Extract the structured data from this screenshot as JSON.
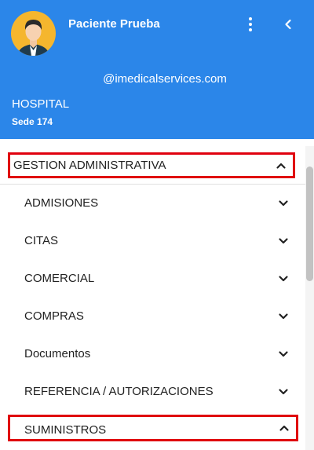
{
  "header": {
    "user_name": "Paciente Prueba",
    "email": "@imedicalservices.com",
    "organization": "HOSPITAL",
    "site": "Sede 174",
    "avatar_bg": "#f5b62e",
    "bg_color": "#2b86e9",
    "menu_icon": "more-vert-icon",
    "collapse_icon": "chevron-left-icon"
  },
  "menu": {
    "group_label": "GESTION ADMINISTRATIVA",
    "group_expanded": true,
    "items": [
      {
        "label": "ADMISIONES",
        "expanded": false
      },
      {
        "label": "CITAS",
        "expanded": false
      },
      {
        "label": "COMERCIAL",
        "expanded": false
      },
      {
        "label": "COMPRAS",
        "expanded": false
      },
      {
        "label": "Documentos",
        "expanded": false
      },
      {
        "label": "REFERENCIA / AUTORIZACIONES",
        "expanded": false
      },
      {
        "label": "SUMINISTROS",
        "expanded": true
      }
    ],
    "highlight_color": "#e0000e"
  }
}
